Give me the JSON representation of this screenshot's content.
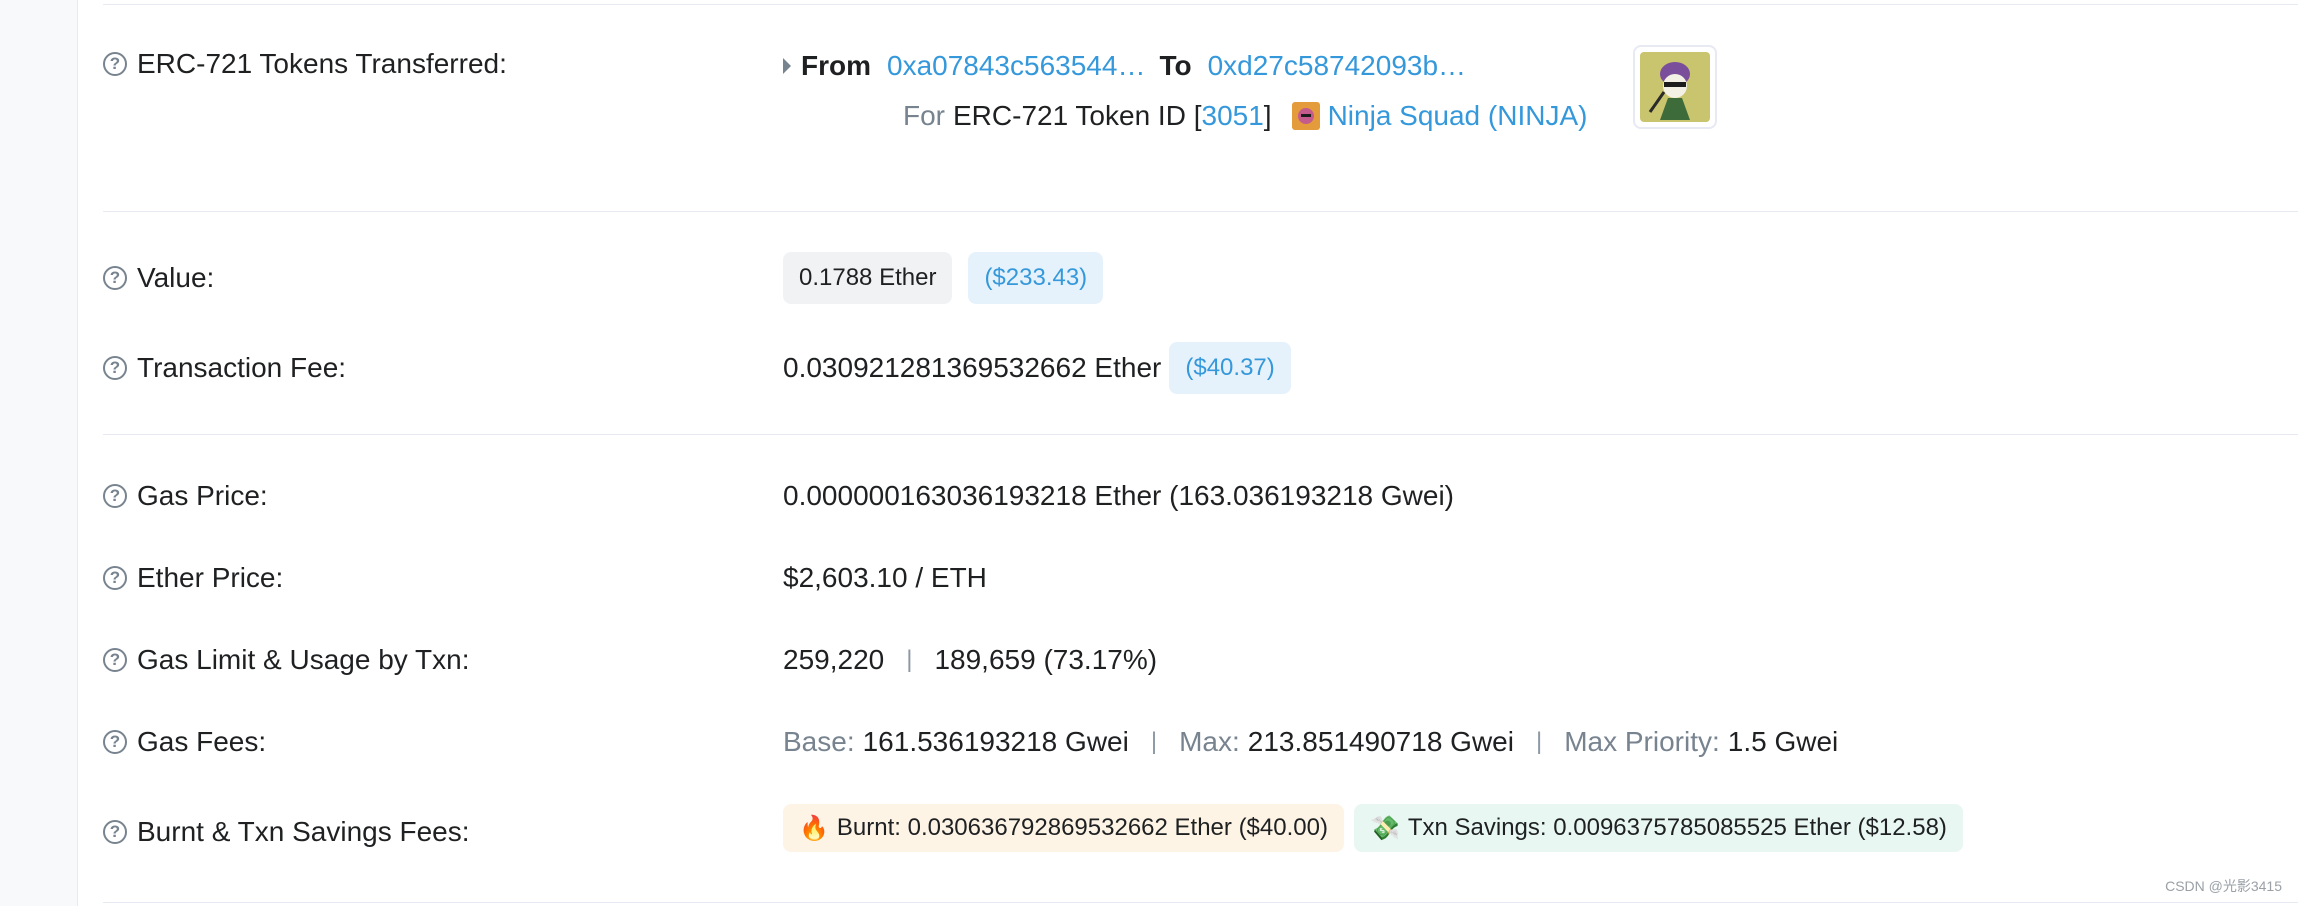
{
  "erc721": {
    "label": "ERC-721 Tokens Transferred:",
    "from_label": "From",
    "from_address": "0xa07843c563544…",
    "to_label": "To",
    "to_address": "0xd27c58742093b…",
    "for_label": "For",
    "token_text": "ERC-721 Token ID [",
    "token_id": "3051",
    "token_close": "]",
    "collection": "Ninja Squad (NINJA)"
  },
  "value": {
    "label": "Value:",
    "ether": "0.1788 Ether",
    "usd": "($233.43)"
  },
  "fee": {
    "label": "Transaction Fee:",
    "ether": "0.030921281369532662 Ether",
    "usd": "($40.37)"
  },
  "gas_price": {
    "label": "Gas Price:",
    "value": "0.000000163036193218 Ether (163.036193218 Gwei)"
  },
  "ether_price": {
    "label": "Ether Price:",
    "value": "$2,603.10 / ETH"
  },
  "gas_limit": {
    "label": "Gas Limit & Usage by Txn:",
    "limit": "259,220",
    "separator": "|",
    "usage": "189,659 (73.17%)"
  },
  "gas_fees": {
    "label": "Gas Fees:",
    "base_label": "Base:",
    "base_value": "161.536193218 Gwei",
    "max_label": "Max:",
    "max_value": "213.851490718 Gwei",
    "priority_label": "Max Priority:",
    "priority_value": "1.5 Gwei",
    "separator": "|"
  },
  "burnt": {
    "label": "Burnt & Txn Savings Fees:",
    "burnt_icon": "🔥",
    "burnt_text": "Burnt: 0.030636792869532662 Ether ($40.00)",
    "savings_icon": "💸",
    "savings_text": "Txn Savings: 0.0096375785085525 Ether ($12.58)"
  },
  "help_icon": "?",
  "watermark": "CSDN @光影3415"
}
